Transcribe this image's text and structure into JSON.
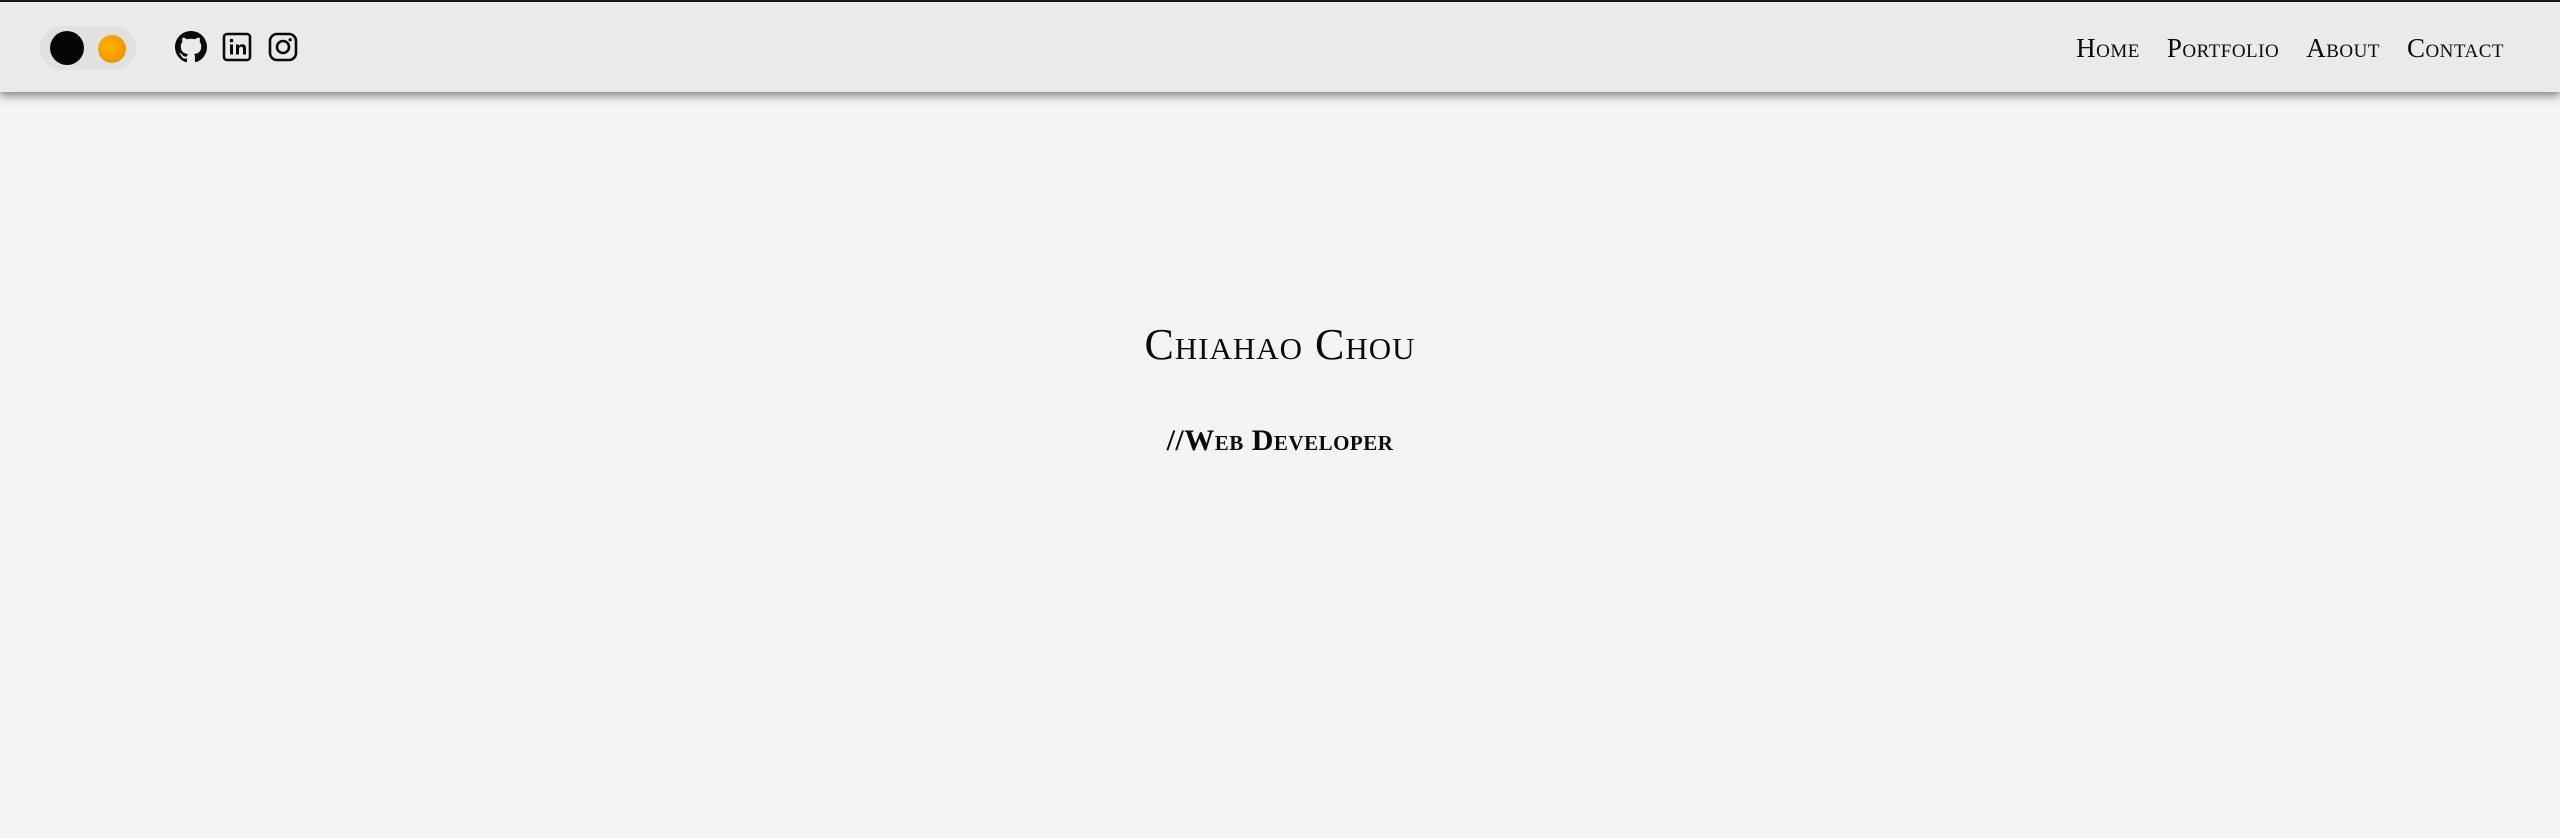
{
  "header": {
    "theme_toggle": {
      "dark_color": "#050505",
      "light_color": "#f59a00"
    },
    "social_links": [
      {
        "icon": "github-icon"
      },
      {
        "icon": "linkedin-icon"
      },
      {
        "icon": "instagram-icon"
      }
    ],
    "nav": {
      "home": "Home",
      "portfolio": "Portfolio",
      "about": "About",
      "contact": "Contact"
    }
  },
  "hero": {
    "name": "Chiahao Chou",
    "role": "//Web Developer"
  }
}
